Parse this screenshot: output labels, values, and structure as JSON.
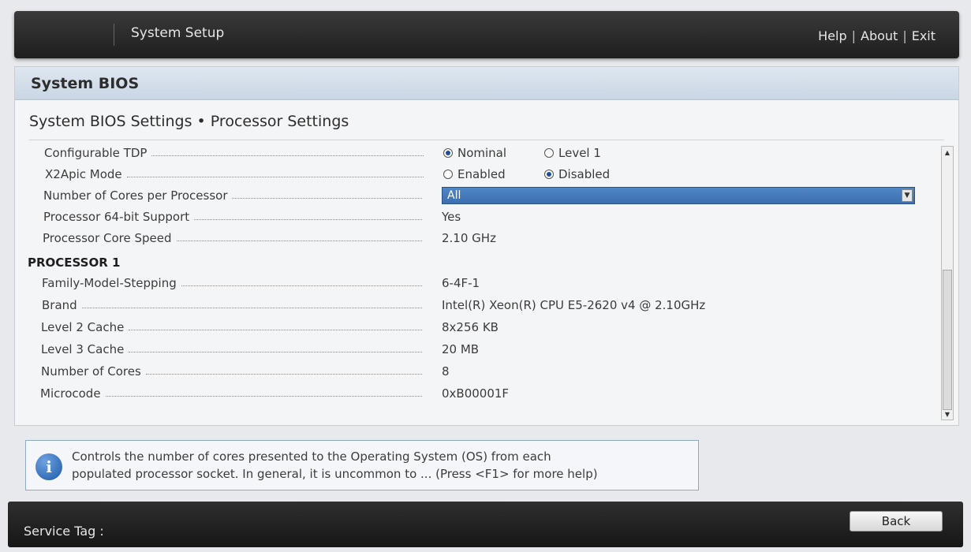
{
  "header": {
    "title": "System Setup",
    "links": [
      "Help",
      "About",
      "Exit"
    ],
    "separator": "|"
  },
  "panel": {
    "title": "System BIOS",
    "breadcrumb": "System BIOS Settings • Processor Settings"
  },
  "settings": {
    "configurable_tdp": {
      "label": "Configurable TDP",
      "options": [
        "Nominal",
        "Level 1"
      ],
      "selected": "Nominal"
    },
    "x2apic_mode": {
      "label": "X2Apic Mode",
      "options": [
        "Enabled",
        "Disabled"
      ],
      "selected": "Disabled"
    },
    "cores_per_processor": {
      "label": "Number of Cores per Processor",
      "value": "All"
    },
    "processor_64bit": {
      "label": "Processor 64-bit Support",
      "value": "Yes"
    },
    "core_speed": {
      "label": "Processor Core Speed",
      "value": "2.10 GHz"
    }
  },
  "processor1": {
    "heading": "PROCESSOR 1",
    "rows": [
      {
        "label": "Family-Model-Stepping",
        "value": "6-4F-1"
      },
      {
        "label": "Brand",
        "value": "Intel(R) Xeon(R) CPU E5-2620 v4 @ 2.10GHz"
      },
      {
        "label": "Level 2 Cache",
        "value": "8x256 KB"
      },
      {
        "label": "Level 3 Cache",
        "value": "20 MB"
      },
      {
        "label": "Number of Cores",
        "value": "8"
      },
      {
        "label": "Microcode",
        "value": "0xB00001F"
      }
    ]
  },
  "help": {
    "line1": "Controls the number of cores presented to the Operating System (OS) from each",
    "line2": "populated processor socket. In general, it is uncommon to ... (Press <F1> for more help)"
  },
  "footer": {
    "service_tag_label": "Service Tag :",
    "back_label": "Back"
  },
  "icons": {
    "info": "info-icon",
    "dropdown": "chevron-down-icon"
  }
}
